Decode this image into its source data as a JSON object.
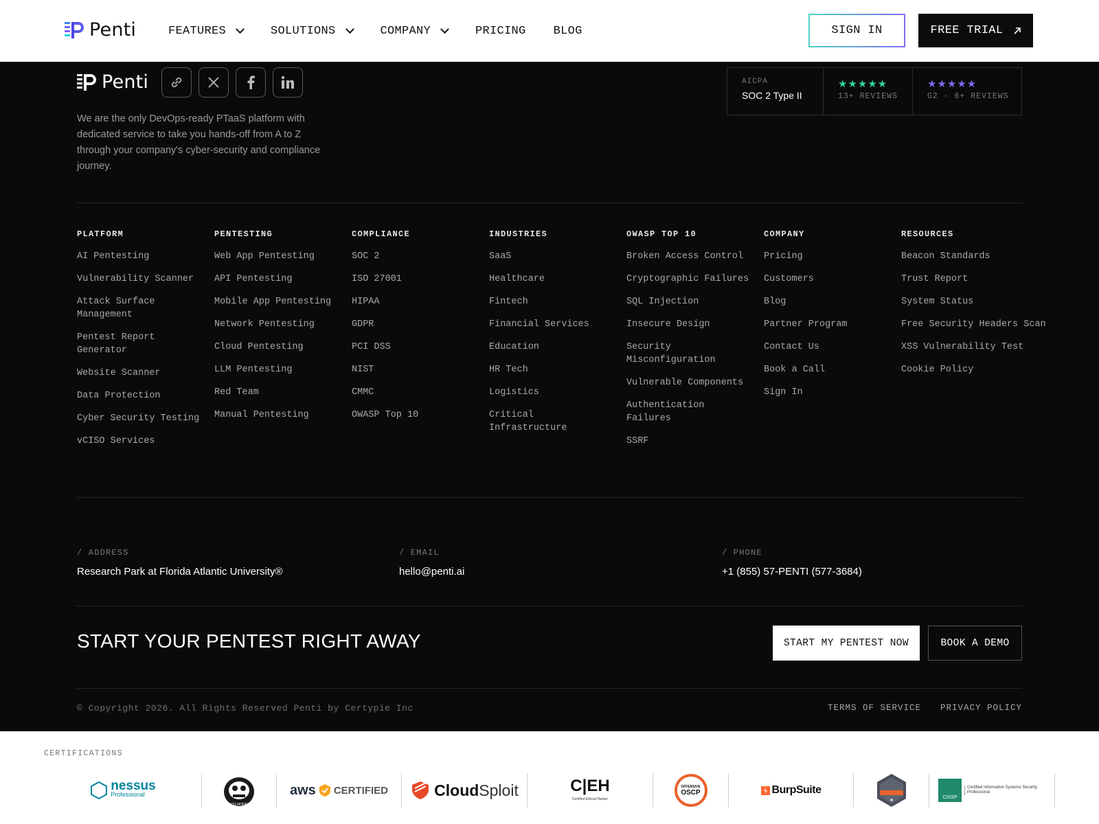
{
  "brand": {
    "name": "Penti"
  },
  "nav": {
    "items": [
      {
        "label": "FEATURES",
        "dropdown": true
      },
      {
        "label": "SOLUTIONS",
        "dropdown": true
      },
      {
        "label": "COMPANY",
        "dropdown": true
      },
      {
        "label": "PRICING",
        "dropdown": false
      },
      {
        "label": "BLOG",
        "dropdown": false
      }
    ],
    "sign_in": "SIGN IN",
    "free_trial": "FREE TRIAL"
  },
  "footer": {
    "about": "We are the only DevOps-ready PTaaS platform with dedicated service to take you hands-off from A to Z through your company's cyber-security and compliance journey.",
    "socials": [
      "link-icon",
      "x-icon",
      "facebook-icon",
      "linkedin-icon"
    ],
    "badges": {
      "aicpa_top": "AICPA",
      "aicpa_main": "SOC 2 Type II",
      "rating1_stars": "★★★★★",
      "rating1_sub": "13+ REVIEWS",
      "rating2_stars": "★★★★★",
      "rating2_sub": "G2 · 6+ REVIEWS"
    },
    "columns": [
      {
        "heading": "PLATFORM",
        "links": [
          "AI Pentesting",
          "Vulnerability Scanner",
          "Attack Surface Management",
          "Pentest Report Generator",
          "Website Scanner",
          "Data Protection",
          "Cyber Security Testing",
          "vCISO Services"
        ]
      },
      {
        "heading": "PENTESTING",
        "links": [
          "Web App Pentesting",
          "API Pentesting",
          "Mobile App Pentesting",
          "Network Pentesting",
          "Cloud Pentesting",
          "LLM Pentesting",
          "Red Team",
          "Manual Pentesting"
        ]
      },
      {
        "heading": "COMPLIANCE",
        "links": [
          "SOC 2",
          "ISO 27001",
          "HIPAA",
          "GDPR",
          "PCI DSS",
          "NIST",
          "CMMC",
          "OWASP Top 10"
        ]
      },
      {
        "heading": "INDUSTRIES",
        "links": [
          "SaaS",
          "Healthcare",
          "Fintech",
          "Financial Services",
          "Education",
          "HR Tech",
          "Logistics",
          "Critical Infrastructure"
        ]
      },
      {
        "heading": "OWASP TOP 10",
        "links": [
          "Broken Access Control",
          "Cryptographic Failures",
          "SQL Injection",
          "Insecure Design",
          "Security Misconfiguration",
          "Vulnerable Components",
          "Authentication Failures",
          "SSRF"
        ]
      },
      {
        "heading": "COMPANY",
        "links": [
          "Pricing",
          "Customers",
          "Blog",
          "Partner Program",
          "Contact Us",
          "Book a Call",
          "Sign In"
        ]
      },
      {
        "heading": "RESOURCES",
        "links": [
          "Beacon Standards",
          "Trust Report",
          "System Status",
          "Free Security Headers Scan",
          "XSS Vulnerability Test",
          "Cookie Policy"
        ]
      }
    ],
    "contact": {
      "address_label": "/ ADDRESS",
      "address": "Research Park at Florida Atlantic University®",
      "email_label": "/ EMAIL",
      "email": "hello@penti.ai",
      "phone_label": "/ PHONE",
      "phone": "+1 (855) 57-PENTI (577-3684)"
    },
    "cta": {
      "title": "START YOUR PENTEST RIGHT AWAY",
      "start": "START MY PENTEST NOW",
      "demo": "BOOK A DEMO"
    },
    "copyright": "© Copyright 2026. All Rights Reserved Penti by Certypie Inc",
    "legal": [
      "TERMS OF SERVICE",
      "PRIVACY POLICY"
    ]
  },
  "certifications": {
    "label": "CERTIFICATIONS",
    "logos": {
      "nessus": "nessus",
      "nessus_sub": "Professional",
      "chaos": "CHAOS MONKEYS",
      "aws": "aws",
      "aws_cert": "CERTIFIED",
      "cloud_a": "Cloud",
      "cloud_b": "Sploit",
      "ceh": "C|EH",
      "ceh_sub": "Certified Ethical Hacker",
      "oscp_top": "OFFENSIVE",
      "oscp": "OSCP",
      "burp": "BurpSuite",
      "cissp": "CISSP",
      "cissp_desc": "Certified Information Systems Security Professional"
    },
    "colors": {
      "nessus": "#00829b",
      "aws_badge": "#f7a41d",
      "cloudsploit": "#e84a27",
      "oscp": "#e8632a",
      "burp": "#ff6633",
      "cissp": "#1f8a6b"
    }
  }
}
